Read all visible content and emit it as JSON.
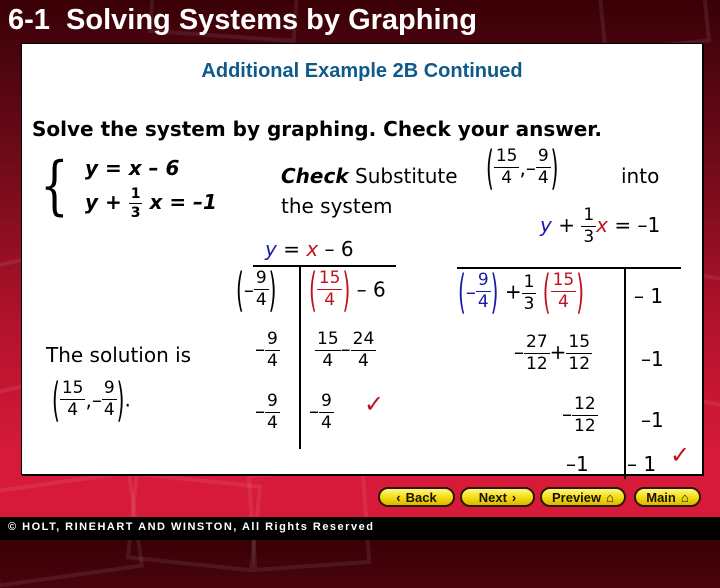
{
  "header": {
    "title": "6-1  Solving Systems by Graphing"
  },
  "panel": {
    "subtitle": "Additional Example 2B Continued",
    "instruction": "Solve the system by graphing. Check your answer.",
    "system": {
      "eq1": "y = x – 6",
      "eq2_left": "y +",
      "eq2_frac_num": "1",
      "eq2_frac_den": "3",
      "eq2_right": "x = –1"
    },
    "check": {
      "label_bold": "Check",
      "label_rest": "Substitute",
      "point_x_num": "15",
      "point_x_den": "4",
      "point_y_sign": "–",
      "point_y_num": "9",
      "point_y_den": "4",
      "into": "into",
      "the_system": "the system"
    },
    "table1": {
      "header_y": "y",
      "header_eq": " = ",
      "header_x": "x",
      "header_rest": " – 6",
      "row1_left": {
        "sign": "–",
        "num": "9",
        "den": "4"
      },
      "row1_right": {
        "num": "15",
        "den": "4",
        "rest": "– 6"
      },
      "row2_left": {
        "sign": "–",
        "num": "9",
        "den": "4"
      },
      "row2_right": {
        "a_num": "15",
        "a_den": "4",
        "op": "–",
        "b_num": "24",
        "b_den": "4"
      },
      "row3_left": {
        "sign": "–",
        "num": "9",
        "den": "4"
      },
      "row3_right": {
        "sign": "–",
        "num": "9",
        "den": "4"
      },
      "check_mark": "✓"
    },
    "table2": {
      "header_y": "y",
      "header_plus": " + ",
      "header_frac_num": "1",
      "header_frac_den": "3",
      "header_x": "x",
      "header_rest": " = –1",
      "row1_left": {
        "sign": "–",
        "num": "9",
        "den": "4",
        "plus": "+",
        "c_num": "1",
        "c_den": "3",
        "x_num": "15",
        "x_den": "4"
      },
      "row1_right": "– 1",
      "row2_left": {
        "sign": "–",
        "a_num": "27",
        "a_den": "12",
        "op": "+",
        "b_num": "15",
        "b_den": "12"
      },
      "row2_right": "–1",
      "row3_left": {
        "sign": "–",
        "num": "12",
        "den": "12"
      },
      "row3_right": "–1",
      "row4_left": "–1",
      "row4_right": "– 1",
      "check_mark": "✓"
    },
    "solution": {
      "text": "The solution is",
      "x_num": "15",
      "x_den": "4",
      "y_sign": "–",
      "y_num": "9",
      "y_den": "4",
      "period": "."
    }
  },
  "nav": {
    "back": "Back",
    "next": "Next",
    "preview": "Preview",
    "main": "Main",
    "back_icon": "chevron-left",
    "next_icon": "chevron-right",
    "home_icon": "house"
  },
  "footer": {
    "copyright": "© HOLT, RINEHART AND WINSTON, All Rights Reserved"
  },
  "colors": {
    "title_text": "#ffffff",
    "subtitle": "#0e5a8a",
    "y_variable": "#1a1aa8",
    "x_variable": "#c0101e",
    "check_mark": "#c0101e",
    "button_fill": "#f6e21a"
  }
}
